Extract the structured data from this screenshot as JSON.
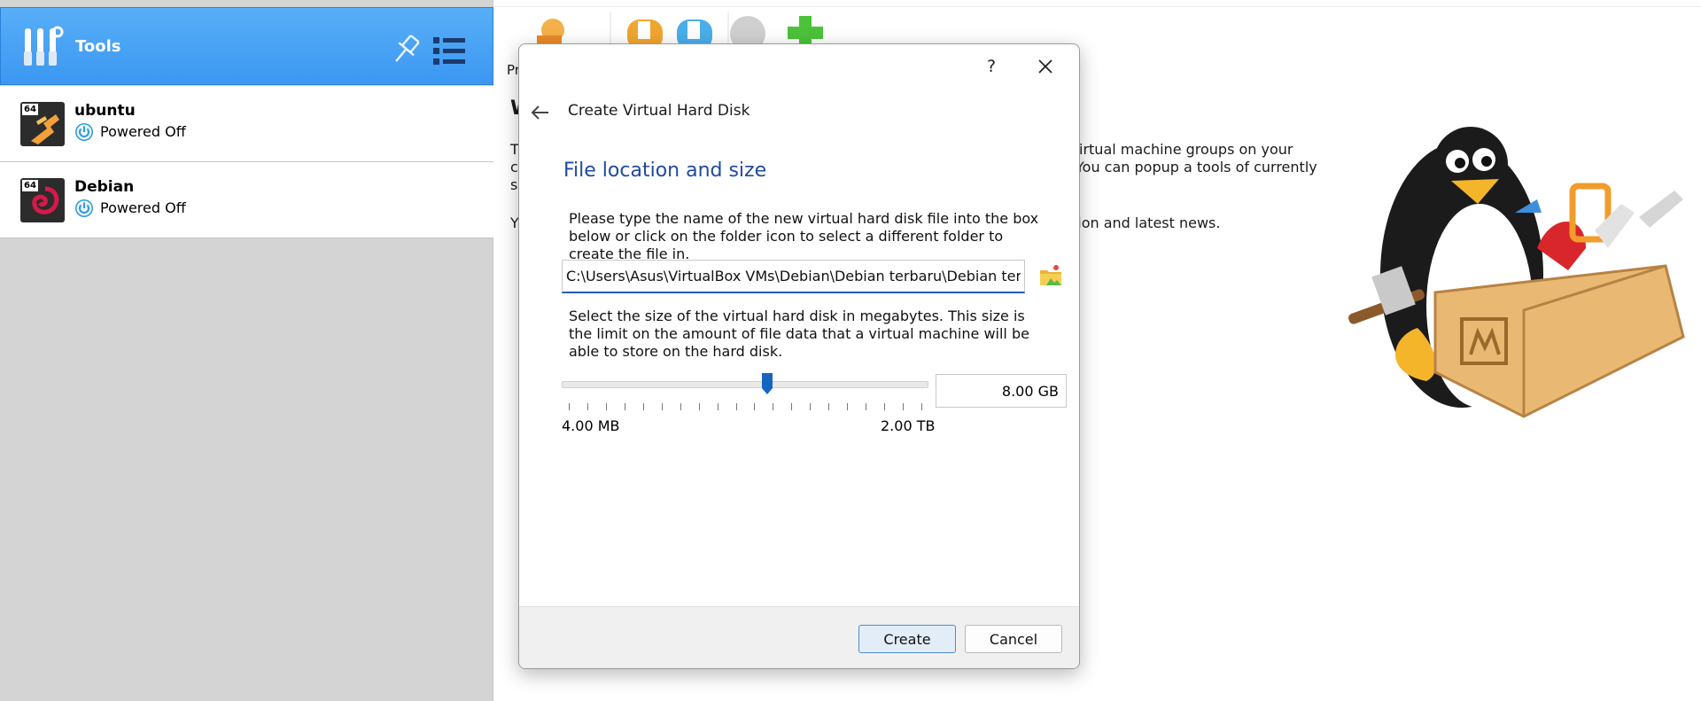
{
  "sidebar": {
    "tools_label": "Tools",
    "vms": [
      {
        "name": "ubuntu",
        "state": "Powered Off",
        "arch_badge": "64",
        "os_icon": "ubuntu-os-icon"
      },
      {
        "name": "Debian",
        "state": "Powered Off",
        "arch_badge": "64",
        "os_icon": "debian-os-icon"
      }
    ]
  },
  "background": {
    "toolbar_frag": "Pr",
    "heading_frag": "W",
    "line1_left": "T",
    "line1_right": "irtual machine groups on your",
    "line2_left": "c",
    "line2_right": "You can popup a tools of currently",
    "line3_left": "se",
    "line4_left": "Y",
    "line4_right": "tion and latest news."
  },
  "dialog": {
    "help_label": "?",
    "title": "Create Virtual Hard Disk",
    "section_title": "File location and size",
    "location_desc": "Please type the name of the new virtual hard disk file into the box below or click on the folder icon to select a different folder to create the file in.",
    "file_path": "C:\\Users\\Asus\\VirtualBox VMs\\Debian\\Debian terbaru\\Debian terbaru.vdi",
    "size_desc": "Select the size of the virtual hard disk in megabytes. This size is the limit on the amount of file data that a virtual machine will be able to store on the hard disk.",
    "size_min": "4.00 MB",
    "size_max": "2.00 TB",
    "size_value": "8.00 GB",
    "slider_fraction": 0.56,
    "create_label": "Create",
    "cancel_label": "Cancel"
  },
  "colors": {
    "accent": "#3b97f2",
    "section_title": "#1f4aa0",
    "power_icon": "#2d9ad8"
  }
}
